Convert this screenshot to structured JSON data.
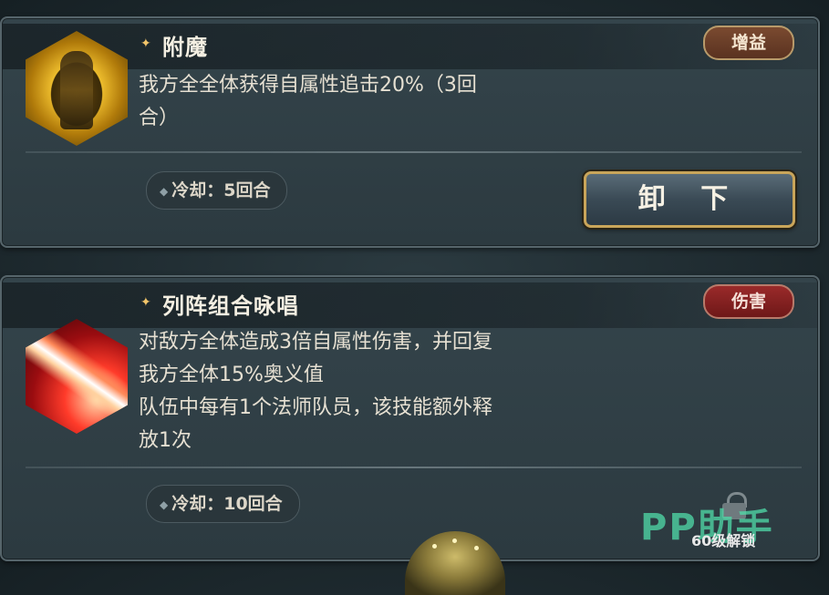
{
  "skills": [
    {
      "title": "附魔",
      "tag": "增益",
      "description": "我方全全体获得自属性追击20%（3回\n合）",
      "cooldown": "冷却：5回合",
      "action_button": "卸 下"
    },
    {
      "title": "列阵组合咏唱",
      "tag": "伤害",
      "description": "对敌方全体造成3倍自属性伤害，并回复\n我方全体15%奥义值\n队伍中每有1个法师队员，该技能额外释\n放1次",
      "cooldown": "冷却：10回合",
      "lock_text": "60级解锁"
    }
  ],
  "watermark": "PP助手",
  "colors": {
    "buff_tag": "#7a4a30",
    "damage_tag": "#9a2a2a",
    "button_border": "#c9a55a",
    "watermark": "#50dcaa"
  }
}
